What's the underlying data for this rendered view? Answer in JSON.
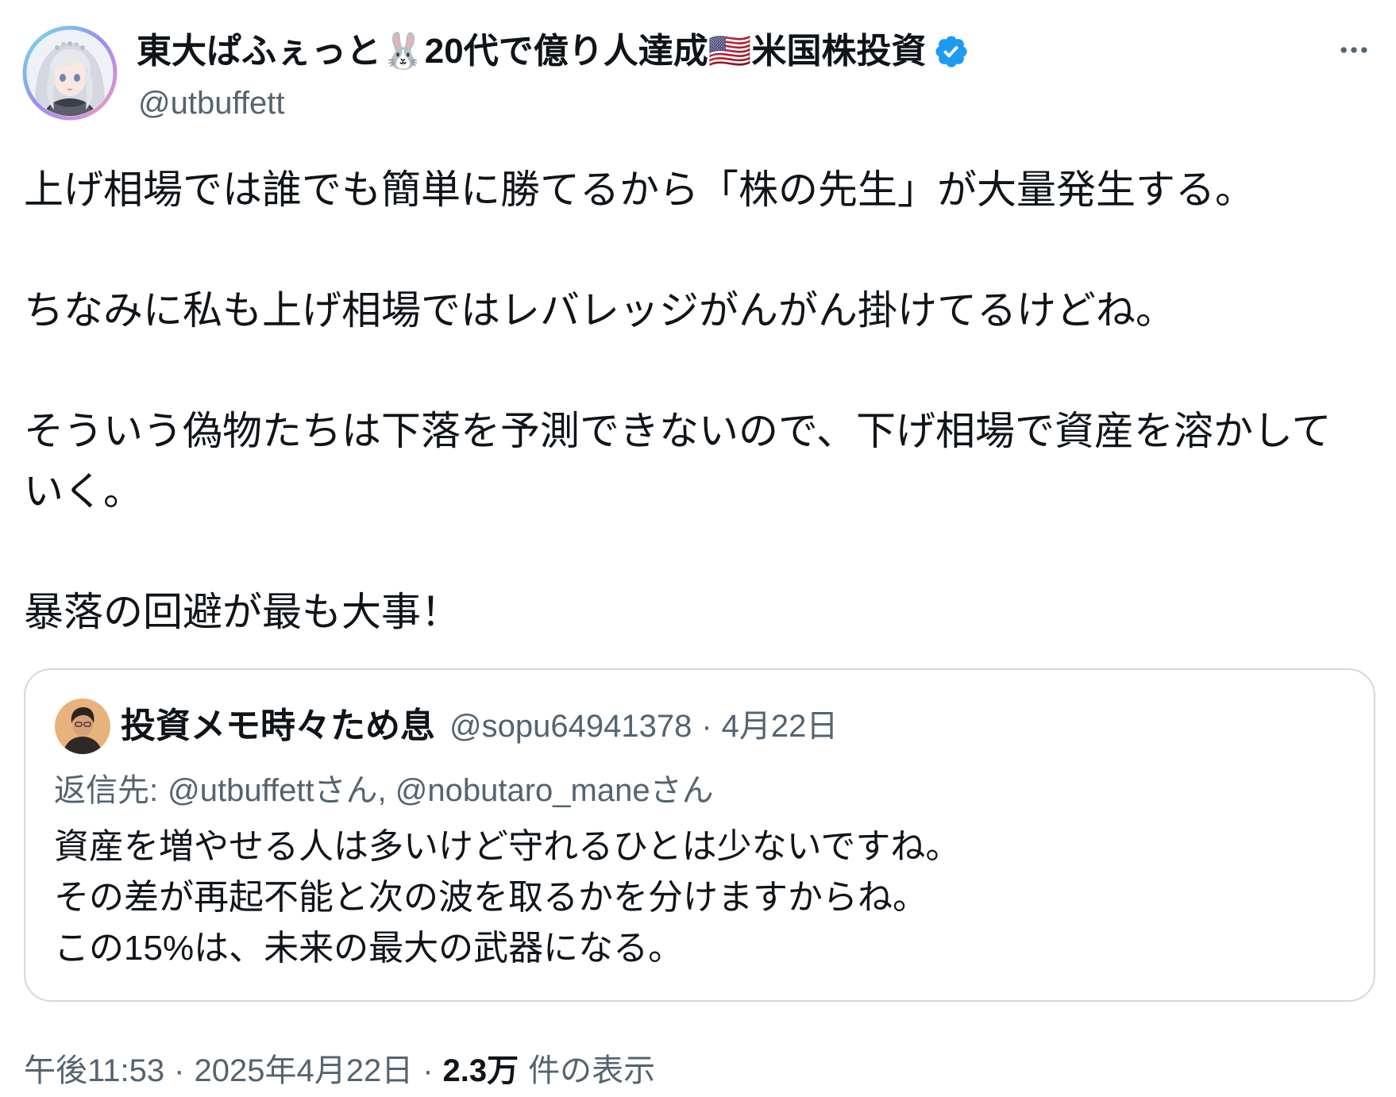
{
  "colors": {
    "background": "#ffffff",
    "text": "#0f1419",
    "secondary": "#536471",
    "border": "#cfd9de",
    "verified": "#1d9bf0"
  },
  "icons": {
    "author_avatar": "anime-girl-avatar",
    "verified": "verified-badge-icon",
    "more": "more-horizontal-icon",
    "quote_avatar": "person-avatar"
  },
  "author": {
    "display_name": "東大ぱふぇっと🐰20代で億り人達成🇺🇸米国株投資",
    "handle": "@utbuffett",
    "verified": true
  },
  "tweet": {
    "paragraphs": [
      "上げ相場では誰でも簡単に勝てるから「株の先生」が大量発生する。",
      "ちなみに私も上げ相場ではレバレッジがんがん掛けてるけどね。",
      "そういう偽物たちは下落を予測できないので、下げ相場で資産を溶かしていく。",
      "暴落の回避が最も大事！"
    ]
  },
  "quote": {
    "display_name": "投資メモ時々ため息",
    "handle": "@sopu64941378",
    "separator": "·",
    "date": "4月22日",
    "reply_to_label": "返信先:",
    "reply_to": "@utbuffettさん, @nobutaro_maneさん",
    "lines": [
      "資産を増やせる人は多いけど守れるひとは少ないですね。",
      "その差が再起不能と次の波を取るかを分けますからね。",
      "この15%は、未来の最大の武器になる。"
    ]
  },
  "footer": {
    "time": "午後11:53",
    "separator": "·",
    "date": "2025年4月22日",
    "views_count": "2.3万",
    "views_label": "件の表示"
  }
}
